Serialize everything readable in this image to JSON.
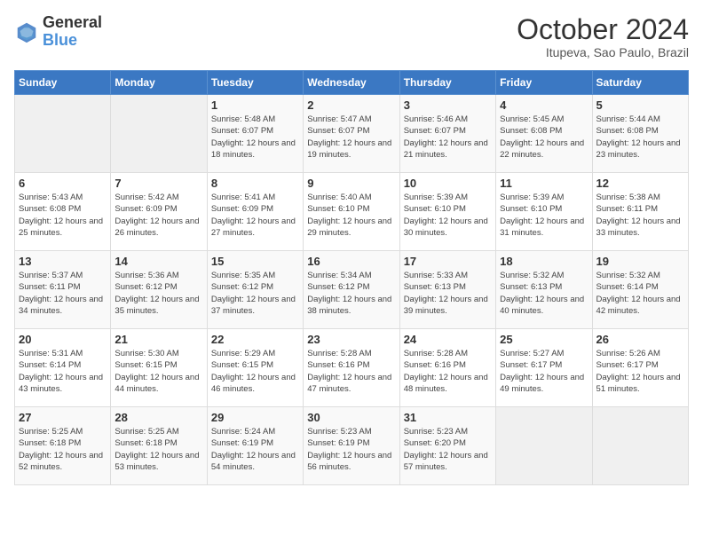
{
  "logo": {
    "text_general": "General",
    "text_blue": "Blue"
  },
  "title": "October 2024",
  "subtitle": "Itupeva, Sao Paulo, Brazil",
  "days_of_week": [
    "Sunday",
    "Monday",
    "Tuesday",
    "Wednesday",
    "Thursday",
    "Friday",
    "Saturday"
  ],
  "weeks": [
    [
      {
        "day": "",
        "sunrise": "",
        "sunset": "",
        "daylight": ""
      },
      {
        "day": "",
        "sunrise": "",
        "sunset": "",
        "daylight": ""
      },
      {
        "day": "1",
        "sunrise": "Sunrise: 5:48 AM",
        "sunset": "Sunset: 6:07 PM",
        "daylight": "Daylight: 12 hours and 18 minutes."
      },
      {
        "day": "2",
        "sunrise": "Sunrise: 5:47 AM",
        "sunset": "Sunset: 6:07 PM",
        "daylight": "Daylight: 12 hours and 19 minutes."
      },
      {
        "day": "3",
        "sunrise": "Sunrise: 5:46 AM",
        "sunset": "Sunset: 6:07 PM",
        "daylight": "Daylight: 12 hours and 21 minutes."
      },
      {
        "day": "4",
        "sunrise": "Sunrise: 5:45 AM",
        "sunset": "Sunset: 6:08 PM",
        "daylight": "Daylight: 12 hours and 22 minutes."
      },
      {
        "day": "5",
        "sunrise": "Sunrise: 5:44 AM",
        "sunset": "Sunset: 6:08 PM",
        "daylight": "Daylight: 12 hours and 23 minutes."
      }
    ],
    [
      {
        "day": "6",
        "sunrise": "Sunrise: 5:43 AM",
        "sunset": "Sunset: 6:08 PM",
        "daylight": "Daylight: 12 hours and 25 minutes."
      },
      {
        "day": "7",
        "sunrise": "Sunrise: 5:42 AM",
        "sunset": "Sunset: 6:09 PM",
        "daylight": "Daylight: 12 hours and 26 minutes."
      },
      {
        "day": "8",
        "sunrise": "Sunrise: 5:41 AM",
        "sunset": "Sunset: 6:09 PM",
        "daylight": "Daylight: 12 hours and 27 minutes."
      },
      {
        "day": "9",
        "sunrise": "Sunrise: 5:40 AM",
        "sunset": "Sunset: 6:10 PM",
        "daylight": "Daylight: 12 hours and 29 minutes."
      },
      {
        "day": "10",
        "sunrise": "Sunrise: 5:39 AM",
        "sunset": "Sunset: 6:10 PM",
        "daylight": "Daylight: 12 hours and 30 minutes."
      },
      {
        "day": "11",
        "sunrise": "Sunrise: 5:39 AM",
        "sunset": "Sunset: 6:10 PM",
        "daylight": "Daylight: 12 hours and 31 minutes."
      },
      {
        "day": "12",
        "sunrise": "Sunrise: 5:38 AM",
        "sunset": "Sunset: 6:11 PM",
        "daylight": "Daylight: 12 hours and 33 minutes."
      }
    ],
    [
      {
        "day": "13",
        "sunrise": "Sunrise: 5:37 AM",
        "sunset": "Sunset: 6:11 PM",
        "daylight": "Daylight: 12 hours and 34 minutes."
      },
      {
        "day": "14",
        "sunrise": "Sunrise: 5:36 AM",
        "sunset": "Sunset: 6:12 PM",
        "daylight": "Daylight: 12 hours and 35 minutes."
      },
      {
        "day": "15",
        "sunrise": "Sunrise: 5:35 AM",
        "sunset": "Sunset: 6:12 PM",
        "daylight": "Daylight: 12 hours and 37 minutes."
      },
      {
        "day": "16",
        "sunrise": "Sunrise: 5:34 AM",
        "sunset": "Sunset: 6:12 PM",
        "daylight": "Daylight: 12 hours and 38 minutes."
      },
      {
        "day": "17",
        "sunrise": "Sunrise: 5:33 AM",
        "sunset": "Sunset: 6:13 PM",
        "daylight": "Daylight: 12 hours and 39 minutes."
      },
      {
        "day": "18",
        "sunrise": "Sunrise: 5:32 AM",
        "sunset": "Sunset: 6:13 PM",
        "daylight": "Daylight: 12 hours and 40 minutes."
      },
      {
        "day": "19",
        "sunrise": "Sunrise: 5:32 AM",
        "sunset": "Sunset: 6:14 PM",
        "daylight": "Daylight: 12 hours and 42 minutes."
      }
    ],
    [
      {
        "day": "20",
        "sunrise": "Sunrise: 5:31 AM",
        "sunset": "Sunset: 6:14 PM",
        "daylight": "Daylight: 12 hours and 43 minutes."
      },
      {
        "day": "21",
        "sunrise": "Sunrise: 5:30 AM",
        "sunset": "Sunset: 6:15 PM",
        "daylight": "Daylight: 12 hours and 44 minutes."
      },
      {
        "day": "22",
        "sunrise": "Sunrise: 5:29 AM",
        "sunset": "Sunset: 6:15 PM",
        "daylight": "Daylight: 12 hours and 46 minutes."
      },
      {
        "day": "23",
        "sunrise": "Sunrise: 5:28 AM",
        "sunset": "Sunset: 6:16 PM",
        "daylight": "Daylight: 12 hours and 47 minutes."
      },
      {
        "day": "24",
        "sunrise": "Sunrise: 5:28 AM",
        "sunset": "Sunset: 6:16 PM",
        "daylight": "Daylight: 12 hours and 48 minutes."
      },
      {
        "day": "25",
        "sunrise": "Sunrise: 5:27 AM",
        "sunset": "Sunset: 6:17 PM",
        "daylight": "Daylight: 12 hours and 49 minutes."
      },
      {
        "day": "26",
        "sunrise": "Sunrise: 5:26 AM",
        "sunset": "Sunset: 6:17 PM",
        "daylight": "Daylight: 12 hours and 51 minutes."
      }
    ],
    [
      {
        "day": "27",
        "sunrise": "Sunrise: 5:25 AM",
        "sunset": "Sunset: 6:18 PM",
        "daylight": "Daylight: 12 hours and 52 minutes."
      },
      {
        "day": "28",
        "sunrise": "Sunrise: 5:25 AM",
        "sunset": "Sunset: 6:18 PM",
        "daylight": "Daylight: 12 hours and 53 minutes."
      },
      {
        "day": "29",
        "sunrise": "Sunrise: 5:24 AM",
        "sunset": "Sunset: 6:19 PM",
        "daylight": "Daylight: 12 hours and 54 minutes."
      },
      {
        "day": "30",
        "sunrise": "Sunrise: 5:23 AM",
        "sunset": "Sunset: 6:19 PM",
        "daylight": "Daylight: 12 hours and 56 minutes."
      },
      {
        "day": "31",
        "sunrise": "Sunrise: 5:23 AM",
        "sunset": "Sunset: 6:20 PM",
        "daylight": "Daylight: 12 hours and 57 minutes."
      },
      {
        "day": "",
        "sunrise": "",
        "sunset": "",
        "daylight": ""
      },
      {
        "day": "",
        "sunrise": "",
        "sunset": "",
        "daylight": ""
      }
    ]
  ]
}
